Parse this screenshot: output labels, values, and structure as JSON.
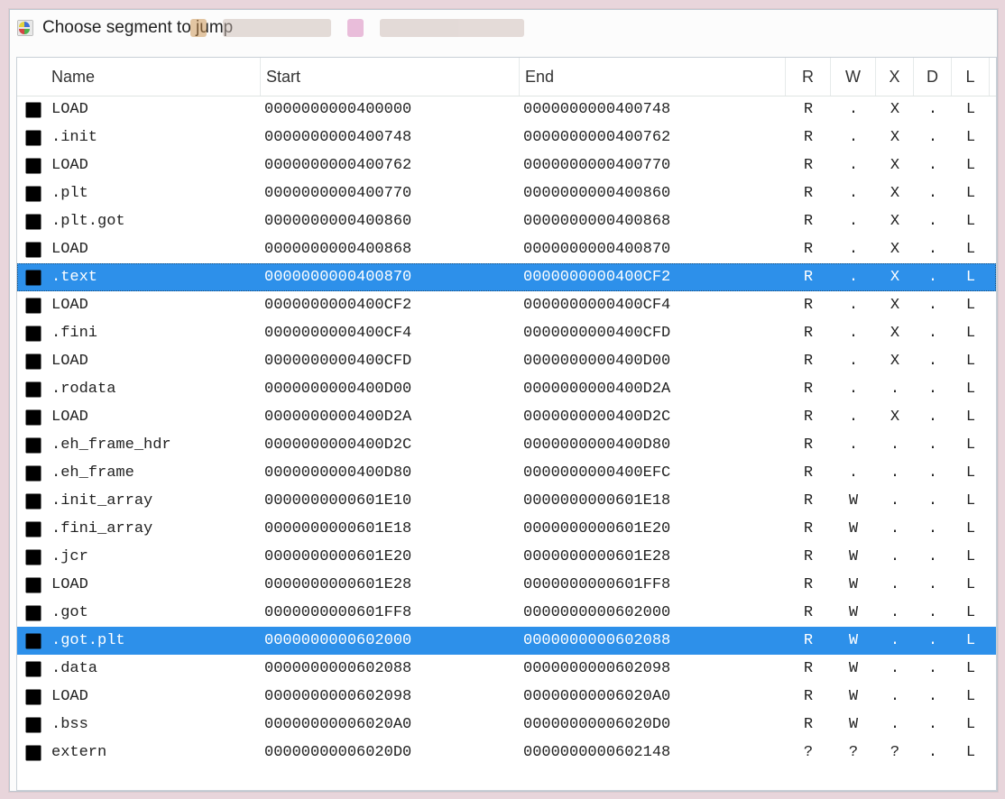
{
  "title": "Choose segment to jump",
  "columns": {
    "name": "Name",
    "start": "Start",
    "end": "End",
    "r": "R",
    "w": "W",
    "x": "X",
    "d": "D",
    "l": "L"
  },
  "segments": [
    {
      "name": "LOAD",
      "start": "0000000000400000",
      "end": "0000000000400748",
      "r": "R",
      "w": ".",
      "x": "X",
      "d": ".",
      "l": "L",
      "sel": false,
      "focus": false
    },
    {
      "name": ".init",
      "start": "0000000000400748",
      "end": "0000000000400762",
      "r": "R",
      "w": ".",
      "x": "X",
      "d": ".",
      "l": "L",
      "sel": false,
      "focus": false
    },
    {
      "name": "LOAD",
      "start": "0000000000400762",
      "end": "0000000000400770",
      "r": "R",
      "w": ".",
      "x": "X",
      "d": ".",
      "l": "L",
      "sel": false,
      "focus": false
    },
    {
      "name": ".plt",
      "start": "0000000000400770",
      "end": "0000000000400860",
      "r": "R",
      "w": ".",
      "x": "X",
      "d": ".",
      "l": "L",
      "sel": false,
      "focus": false
    },
    {
      "name": ".plt.got",
      "start": "0000000000400860",
      "end": "0000000000400868",
      "r": "R",
      "w": ".",
      "x": "X",
      "d": ".",
      "l": "L",
      "sel": false,
      "focus": false
    },
    {
      "name": "LOAD",
      "start": "0000000000400868",
      "end": "0000000000400870",
      "r": "R",
      "w": ".",
      "x": "X",
      "d": ".",
      "l": "L",
      "sel": false,
      "focus": false
    },
    {
      "name": ".text",
      "start": "0000000000400870",
      "end": "0000000000400CF2",
      "r": "R",
      "w": ".",
      "x": "X",
      "d": ".",
      "l": "L",
      "sel": true,
      "focus": true
    },
    {
      "name": "LOAD",
      "start": "0000000000400CF2",
      "end": "0000000000400CF4",
      "r": "R",
      "w": ".",
      "x": "X",
      "d": ".",
      "l": "L",
      "sel": false,
      "focus": false
    },
    {
      "name": ".fini",
      "start": "0000000000400CF4",
      "end": "0000000000400CFD",
      "r": "R",
      "w": ".",
      "x": "X",
      "d": ".",
      "l": "L",
      "sel": false,
      "focus": false
    },
    {
      "name": "LOAD",
      "start": "0000000000400CFD",
      "end": "0000000000400D00",
      "r": "R",
      "w": ".",
      "x": "X",
      "d": ".",
      "l": "L",
      "sel": false,
      "focus": false
    },
    {
      "name": ".rodata",
      "start": "0000000000400D00",
      "end": "0000000000400D2A",
      "r": "R",
      "w": ".",
      "x": ".",
      "d": ".",
      "l": "L",
      "sel": false,
      "focus": false
    },
    {
      "name": "LOAD",
      "start": "0000000000400D2A",
      "end": "0000000000400D2C",
      "r": "R",
      "w": ".",
      "x": "X",
      "d": ".",
      "l": "L",
      "sel": false,
      "focus": false
    },
    {
      "name": ".eh_frame_hdr",
      "start": "0000000000400D2C",
      "end": "0000000000400D80",
      "r": "R",
      "w": ".",
      "x": ".",
      "d": ".",
      "l": "L",
      "sel": false,
      "focus": false
    },
    {
      "name": ".eh_frame",
      "start": "0000000000400D80",
      "end": "0000000000400EFC",
      "r": "R",
      "w": ".",
      "x": ".",
      "d": ".",
      "l": "L",
      "sel": false,
      "focus": false
    },
    {
      "name": ".init_array",
      "start": "0000000000601E10",
      "end": "0000000000601E18",
      "r": "R",
      "w": "W",
      "x": ".",
      "d": ".",
      "l": "L",
      "sel": false,
      "focus": false
    },
    {
      "name": ".fini_array",
      "start": "0000000000601E18",
      "end": "0000000000601E20",
      "r": "R",
      "w": "W",
      "x": ".",
      "d": ".",
      "l": "L",
      "sel": false,
      "focus": false
    },
    {
      "name": ".jcr",
      "start": "0000000000601E20",
      "end": "0000000000601E28",
      "r": "R",
      "w": "W",
      "x": ".",
      "d": ".",
      "l": "L",
      "sel": false,
      "focus": false
    },
    {
      "name": "LOAD",
      "start": "0000000000601E28",
      "end": "0000000000601FF8",
      "r": "R",
      "w": "W",
      "x": ".",
      "d": ".",
      "l": "L",
      "sel": false,
      "focus": false
    },
    {
      "name": ".got",
      "start": "0000000000601FF8",
      "end": "0000000000602000",
      "r": "R",
      "w": "W",
      "x": ".",
      "d": ".",
      "l": "L",
      "sel": false,
      "focus": false
    },
    {
      "name": ".got.plt",
      "start": "0000000000602000",
      "end": "0000000000602088",
      "r": "R",
      "w": "W",
      "x": ".",
      "d": ".",
      "l": "L",
      "sel": true,
      "focus": false
    },
    {
      "name": ".data",
      "start": "0000000000602088",
      "end": "0000000000602098",
      "r": "R",
      "w": "W",
      "x": ".",
      "d": ".",
      "l": "L",
      "sel": false,
      "focus": false
    },
    {
      "name": "LOAD",
      "start": "0000000000602098",
      "end": "00000000006020A0",
      "r": "R",
      "w": "W",
      "x": ".",
      "d": ".",
      "l": "L",
      "sel": false,
      "focus": false
    },
    {
      "name": ".bss",
      "start": "00000000006020A0",
      "end": "00000000006020D0",
      "r": "R",
      "w": "W",
      "x": ".",
      "d": ".",
      "l": "L",
      "sel": false,
      "focus": false
    },
    {
      "name": "extern",
      "start": "00000000006020D0",
      "end": "0000000000602148",
      "r": "?",
      "w": "?",
      "x": "?",
      "d": ".",
      "l": "L",
      "sel": false,
      "focus": false
    }
  ]
}
